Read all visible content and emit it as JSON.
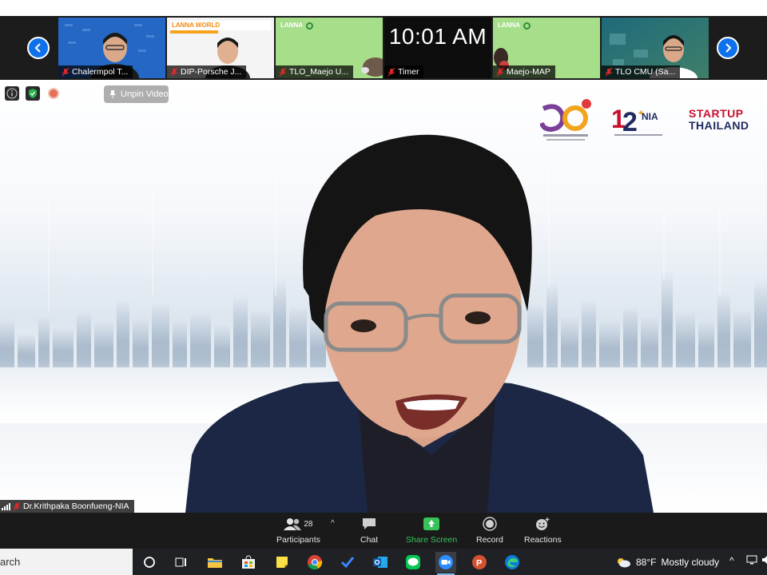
{
  "gallery": {
    "tiles": [
      {
        "name": "Chalermpol T...",
        "muted": true
      },
      {
        "name": "DIP-Porsche J...",
        "muted": true,
        "banner": "LANNA WORLD"
      },
      {
        "name": "TLO_Maejo U...",
        "muted": true,
        "banner": "LANNA"
      },
      {
        "name": "Timer",
        "muted": true,
        "clock": "10:01 AM"
      },
      {
        "name": "Maejo-MAP",
        "muted": true,
        "banner": "LANNA"
      },
      {
        "name": "TLO CMU (Sa...",
        "muted": true
      }
    ]
  },
  "main": {
    "unpin_label": "Unpin Video",
    "speaker_name": "Dr.Krithpaka Boonfueng-NIA",
    "brands": {
      "nia_label": "NIA",
      "startup_line1": "STARTUP",
      "startup_line2": "THAILAND"
    }
  },
  "toolbar": {
    "participants_label": "Participants",
    "participants_count": "28",
    "chat_label": "Chat",
    "share_label": "Share Screen",
    "record_label": "Record",
    "reactions_label": "Reactions"
  },
  "taskbar": {
    "search_text": "arch",
    "weather_temp": "88°F",
    "weather_text": "Mostly cloudy"
  },
  "colors": {
    "zoom_blue": "#0e71eb",
    "share_green": "#37c35a",
    "mute_red": "#e02828",
    "startup_red": "#c8102e"
  }
}
